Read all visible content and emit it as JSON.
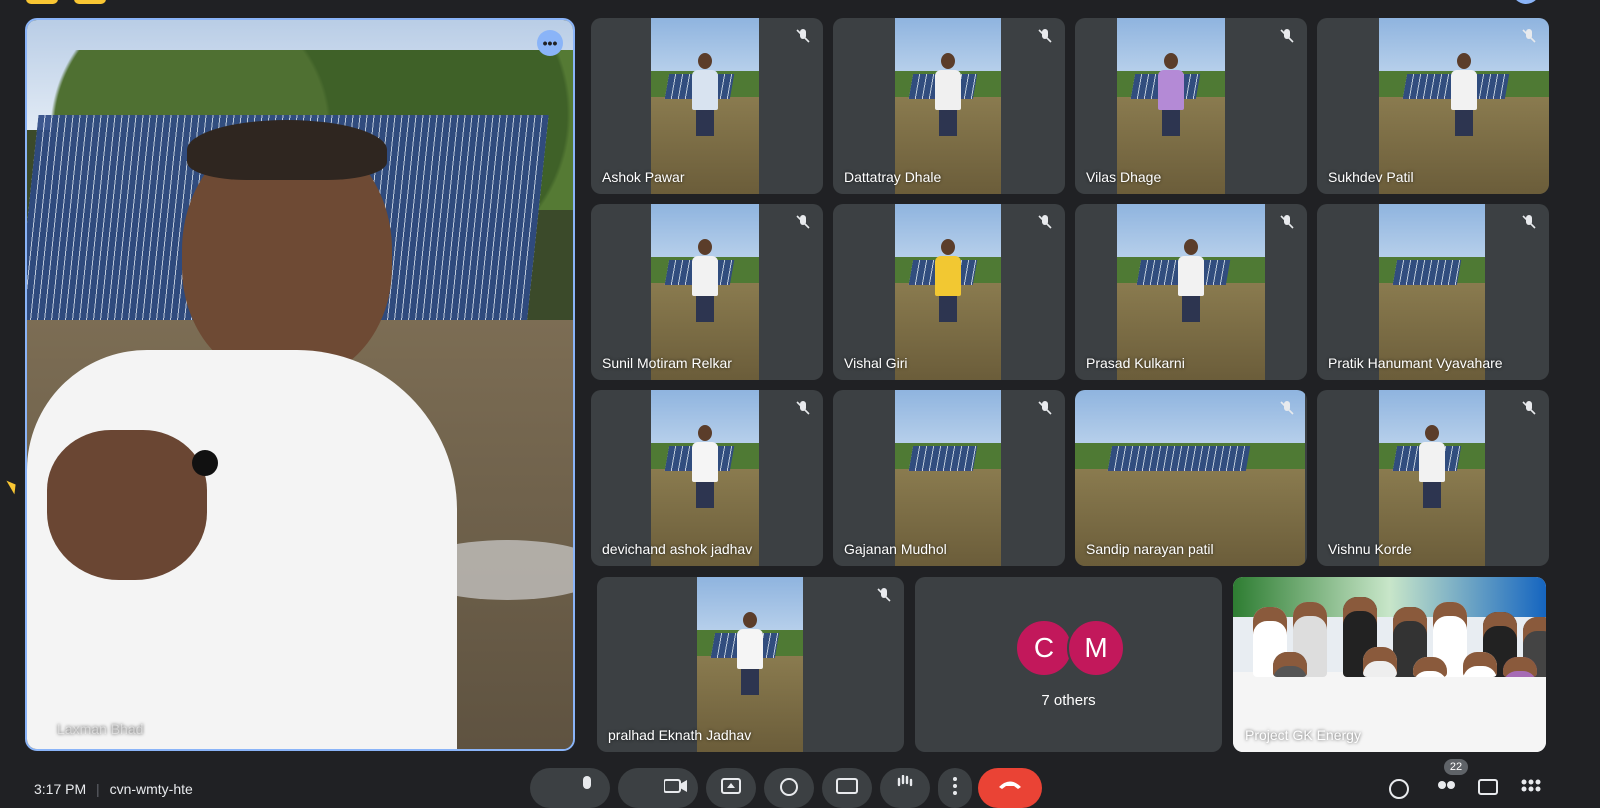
{
  "main_speaker": {
    "name": "Laxman Bhad",
    "menu_icon": "more-horiz-icon"
  },
  "tiles": [
    {
      "name": "Ashok Pawar"
    },
    {
      "name": "Dattatray Dhale"
    },
    {
      "name": "Vilas Dhage"
    },
    {
      "name": "Sukhdev Patil"
    },
    {
      "name": "Sunil Motiram Relkar"
    },
    {
      "name": "Vishal Giri"
    },
    {
      "name": "Prasad Kulkarni"
    },
    {
      "name": "Pratik Hanumant Vyavahare"
    },
    {
      "name": "devichand ashok jadhav"
    },
    {
      "name": "Gajanan Mudhol"
    },
    {
      "name": "Sandip narayan patil"
    },
    {
      "name": "Vishnu Korde"
    },
    {
      "name": "pralhad Eknath Jadhav"
    }
  ],
  "others": {
    "avatars": [
      "C",
      "M"
    ],
    "label": "7 others"
  },
  "presenter_tile": {
    "name": "Project GK Energy"
  },
  "footer": {
    "time": "3:17 PM",
    "meeting_code": "cvn-wmty-hte",
    "participants_count": "22"
  },
  "colors": {
    "background": "#202124",
    "tile": "#3c4043",
    "accent": "#8ab4f8",
    "avatar": "#c2185b",
    "end_call": "#ea4335",
    "chip": "#f9c633"
  },
  "icons": [
    "mic-off-icon",
    "mic-icon",
    "camera-icon",
    "present-icon",
    "emoji-icon",
    "captions-icon",
    "hand-icon",
    "more-vert-icon",
    "end-call-icon",
    "info-icon",
    "people-icon",
    "chat-icon",
    "activities-icon"
  ]
}
